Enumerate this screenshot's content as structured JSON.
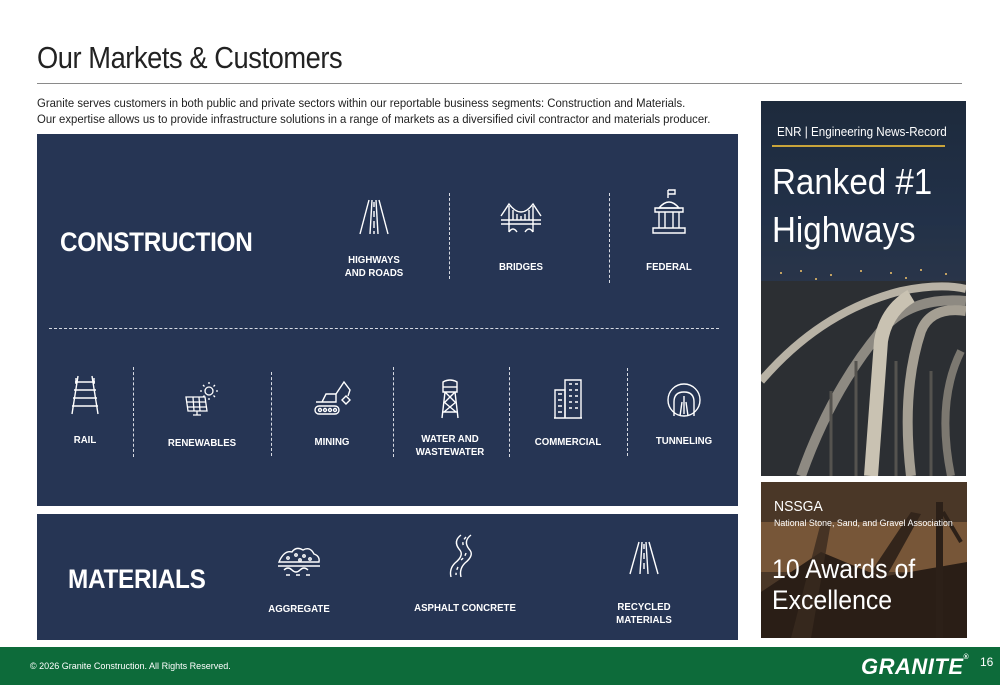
{
  "header": {
    "title": "Our Markets & Customers",
    "intro_line1": "Granite serves customers in both public and private sectors within our reportable business segments: Construction and Materials.",
    "intro_line2": "Our expertise allows us to provide infrastructure solutions in a range of markets as a diversified civil contractor and materials producer."
  },
  "construction": {
    "label": "CONSTRUCTION",
    "top_row": [
      {
        "line1": "HIGHWAYS",
        "line2": "AND ROADS",
        "icon": "highway-icon"
      },
      {
        "line1": "BRIDGES",
        "line2": "",
        "icon": "bridge-icon"
      },
      {
        "line1": "FEDERAL",
        "line2": "",
        "icon": "federal-building-icon"
      }
    ],
    "bottom_row": [
      {
        "line1": "RAIL",
        "line2": "",
        "icon": "rail-icon"
      },
      {
        "line1": "RENEWABLES",
        "line2": "",
        "icon": "solar-panel-icon"
      },
      {
        "line1": "MINING",
        "line2": "",
        "icon": "excavator-icon"
      },
      {
        "line1": "WATER AND",
        "line2": "WASTEWATER",
        "icon": "water-tower-icon"
      },
      {
        "line1": "COMMERCIAL",
        "line2": "",
        "icon": "office-building-icon"
      },
      {
        "line1": "TUNNELING",
        "line2": "",
        "icon": "tunnel-icon"
      }
    ]
  },
  "materials": {
    "label": "MATERIALS",
    "items": [
      {
        "line1": "AGGREGATE",
        "icon": "aggregate-pile-icon"
      },
      {
        "line1": "ASPHALT CONCRETE",
        "icon": "asphalt-road-icon"
      },
      {
        "line1": "RECYCLED MATERIALS",
        "icon": "recycled-road-icon"
      }
    ]
  },
  "enr_card": {
    "source": "ENR | Engineering News-Record",
    "line1": "Ranked #1",
    "line2": "Highways"
  },
  "nssga_card": {
    "org": "NSSGA",
    "org_full": "National Stone, Sand, and Gravel Association",
    "line1": "10 Awards of",
    "line2": "Excellence"
  },
  "footer": {
    "copyright": "© 2026 Granite Construction. All Rights Reserved.",
    "logo": "GRANITE",
    "page_number": "16"
  },
  "colors": {
    "panel": "#263554",
    "footer": "#0d6b3a",
    "gold_rule": "#c9a43a"
  }
}
